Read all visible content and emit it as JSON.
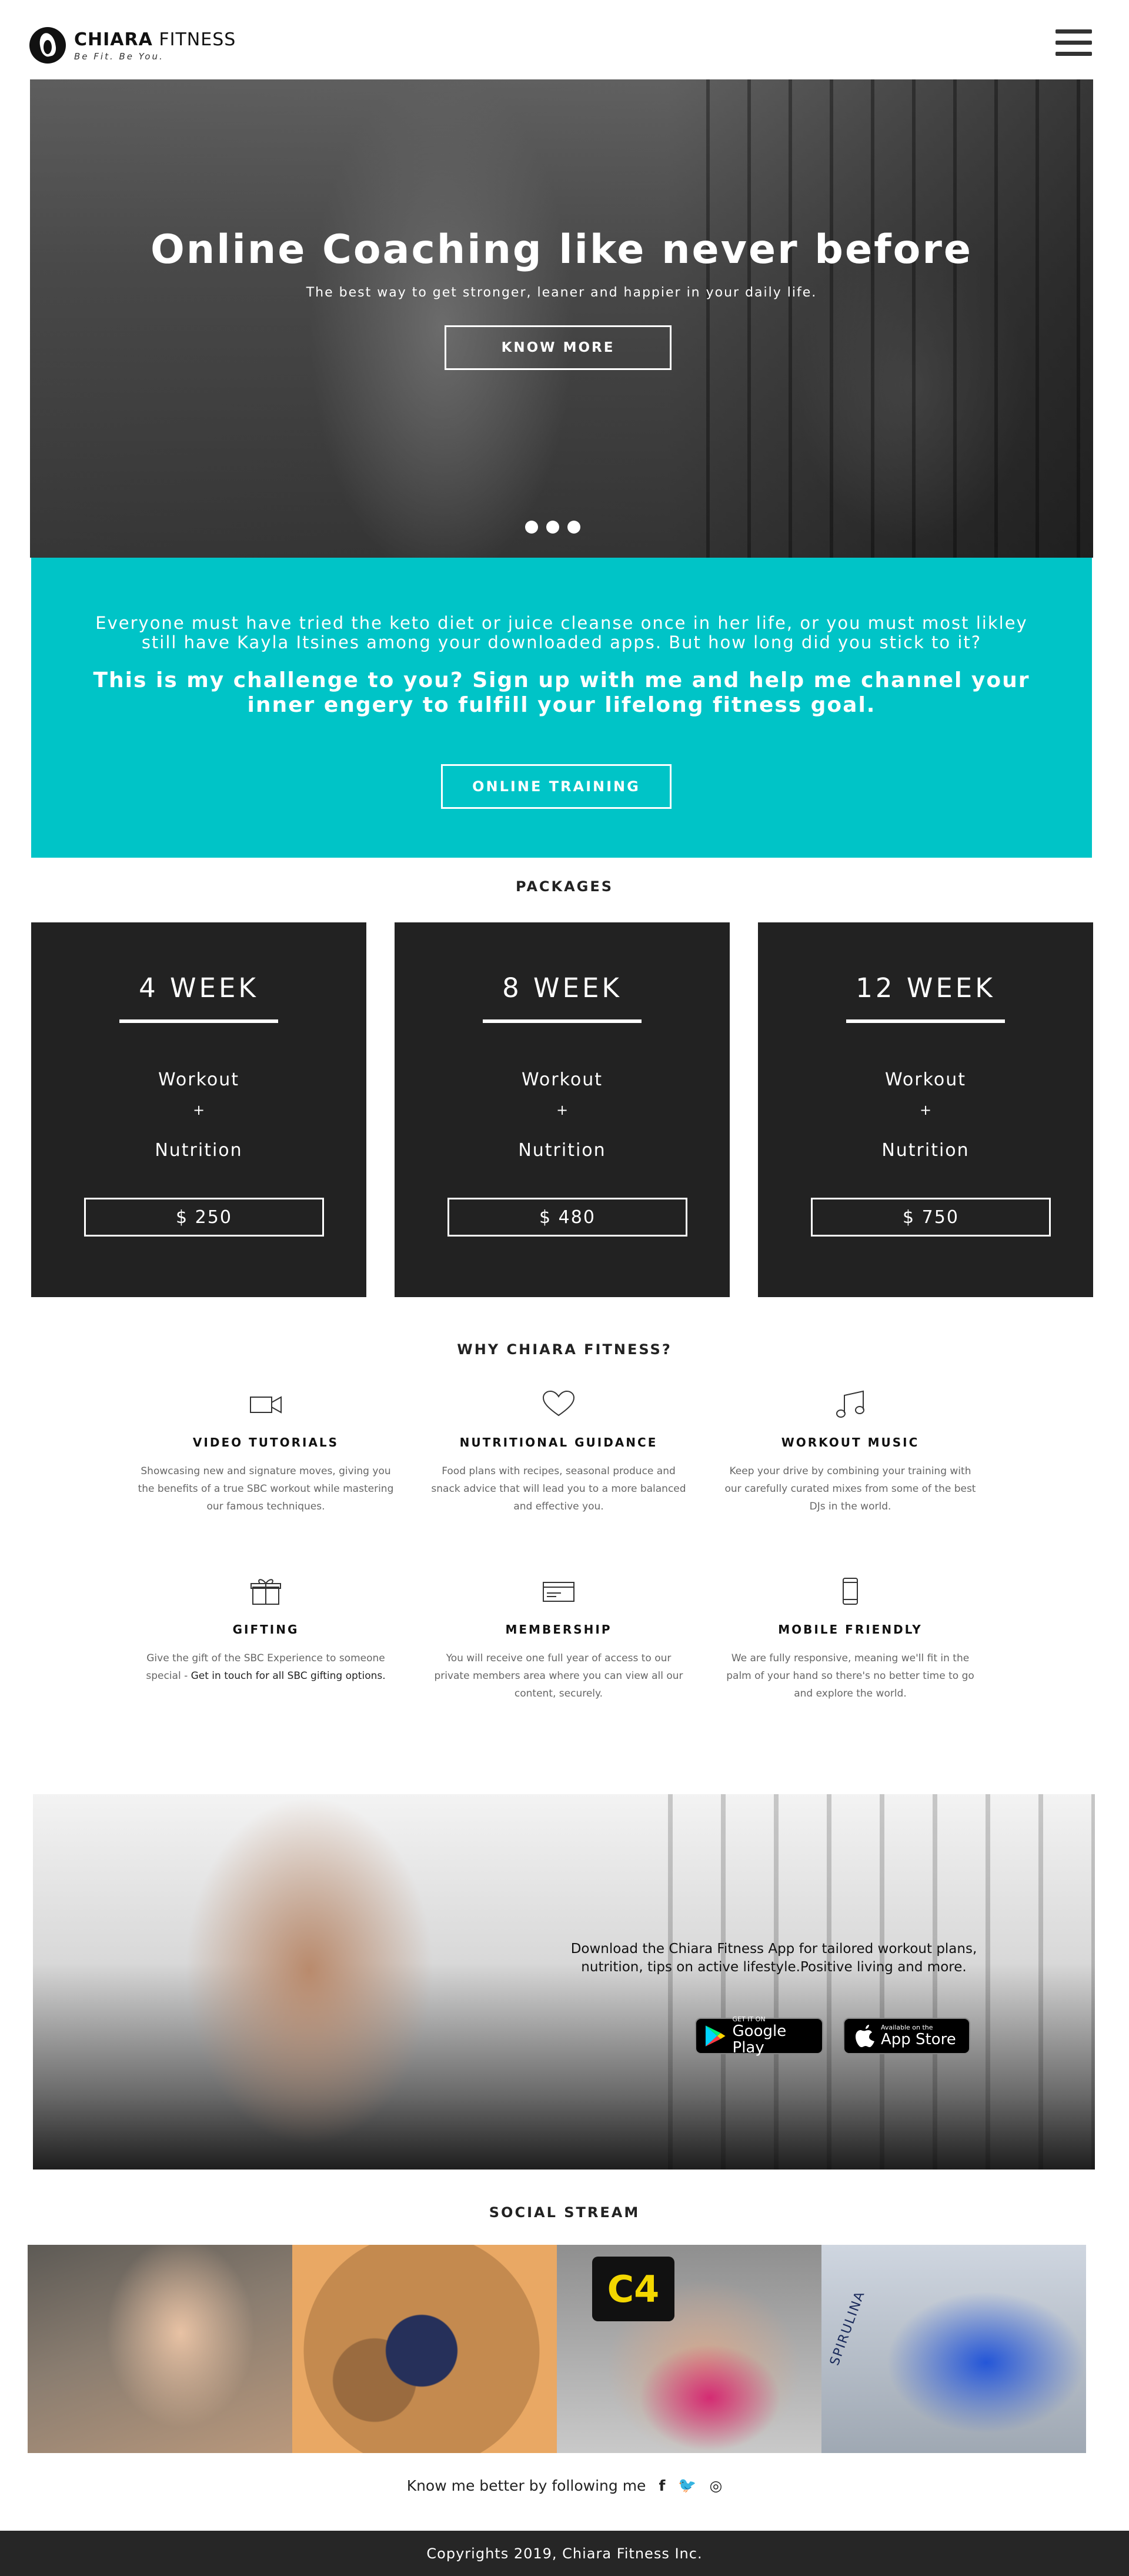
{
  "header": {
    "brand_strong": "CHIARA",
    "brand_light": " FITNESS",
    "tagline": "Be Fit. Be You."
  },
  "hero": {
    "title": "Online Coaching like never before",
    "subtitle": "The best way to get stronger, leaner and happier in your daily life.",
    "button": "KNOW MORE",
    "slides": 3
  },
  "challenge": {
    "text": "Everyone must have tried the keto diet or juice cleanse once in her life, or you must most likley still have Kayla Itsines among your downloaded apps. But how long did you stick to it?",
    "strong": "This is my challenge to you? Sign up with me and help me channel your inner engery to fulfill your lifelong fitness goal.",
    "button": "ONLINE TRAINING",
    "bg_color": "#00c4c7"
  },
  "packages": {
    "title": "PACKAGES",
    "items": [
      {
        "name": "4 WEEK",
        "line1": "Workout",
        "plus": "+",
        "line2": "Nutrition",
        "price": "$ 250"
      },
      {
        "name": "8 WEEK",
        "line1": "Workout",
        "plus": "+",
        "line2": "Nutrition",
        "price": "$ 480"
      },
      {
        "name": "12 WEEK",
        "line1": "Workout",
        "plus": "+",
        "line2": "Nutrition",
        "price": "$ 750"
      }
    ]
  },
  "why": {
    "title": "WHY CHIARA FITNESS?",
    "features": [
      {
        "icon": "video-camera-icon",
        "title": "VIDEO TUTORIALS",
        "desc": "Showcasing new and signature moves, giving you the benefits of a true SBC workout while mastering our famous techniques."
      },
      {
        "icon": "heart-icon",
        "title": "NUTRITIONAL GUIDANCE",
        "desc": "Food plans with recipes, seasonal produce and snack advice that will lead you to a more balanced and effective you."
      },
      {
        "icon": "music-note-icon",
        "title": "WORKOUT MUSIC",
        "desc": "Keep your drive by combining your training with our carefully curated mixes from some of the best DJs in the world."
      },
      {
        "icon": "gift-icon",
        "title": "GIFTING",
        "desc": "Give the gift of the SBC Experience to someone special - ",
        "desc_link": "Get in touch for all SBC gifting options."
      },
      {
        "icon": "membership-card-icon",
        "title": "MEMBERSHIP",
        "desc": "You will receive one full year of access to our private members area where you can view all our content, securely."
      },
      {
        "icon": "mobile-phone-icon",
        "title": "MOBILE FRIENDLY",
        "desc": "We are fully responsive, meaning we'll fit in the palm of your hand so there's no better time to go and explore the world."
      }
    ]
  },
  "app": {
    "text": "Download the Chiara Fitness App for tailored workout plans, nutrition, tips on active lifestyle.Positive living and more.",
    "google_small": "GET IT ON",
    "google_big": "Google Play",
    "apple_small": "Available on the",
    "apple_big": "App Store"
  },
  "social": {
    "title": "SOCIAL STREAM",
    "follow_text": "Know me better by following me",
    "facebook": "f",
    "twitter": "🐦",
    "instagram": "◎",
    "photo_label_3": "C4",
    "photo_label_4": "SPIRULINA"
  },
  "footer": {
    "text": "Copyrights 2019, Chiara Fitness Inc."
  }
}
